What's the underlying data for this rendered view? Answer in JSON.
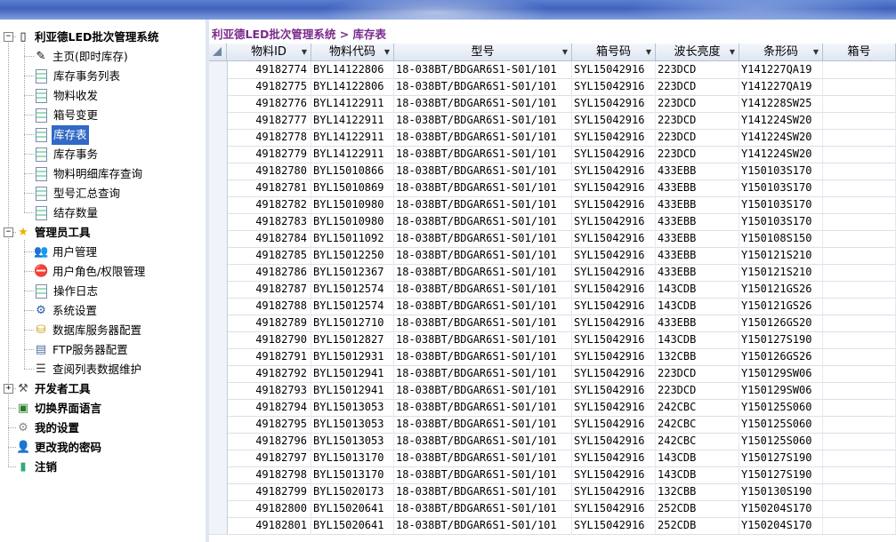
{
  "app": {
    "title": "利亚德LED批次管理系统"
  },
  "breadcrumb": "利亚德LED批次管理系统 > 库存表",
  "tree": [
    {
      "label": "利亚德LED批次管理系统",
      "level": 0,
      "toggle": "−",
      "icon": "book-icon",
      "glyph": "▯"
    },
    {
      "label": "主页(即时库存)",
      "level": 1,
      "icon": "edit-page-icon",
      "glyph": "✎"
    },
    {
      "label": "库存事务列表",
      "level": 1,
      "icon": "page-icon"
    },
    {
      "label": "物料收发",
      "level": 1,
      "icon": "page-icon"
    },
    {
      "label": "箱号变更",
      "level": 1,
      "icon": "page-icon"
    },
    {
      "label": "库存表",
      "level": 1,
      "icon": "page-icon",
      "selected": true
    },
    {
      "label": "库存事务",
      "level": 1,
      "icon": "page-icon"
    },
    {
      "label": "物料明细库存查询",
      "level": 1,
      "icon": "page-icon"
    },
    {
      "label": "型号汇总查询",
      "level": 1,
      "icon": "page-icon"
    },
    {
      "label": "结存数量",
      "level": 1,
      "icon": "page-icon"
    },
    {
      "label": "管理员工具",
      "level": 0,
      "toggle": "−",
      "icon": "star-icon",
      "glyph": "★",
      "color": "#e8b300"
    },
    {
      "label": "用户管理",
      "level": 1,
      "icon": "users-icon",
      "glyph": "👥",
      "color": "#2b6cb0"
    },
    {
      "label": "用户角色/权限管理",
      "level": 1,
      "icon": "no-entry-icon",
      "glyph": "⛔",
      "color": "#d22"
    },
    {
      "label": "操作日志",
      "level": 1,
      "icon": "page-icon"
    },
    {
      "label": "系统设置",
      "level": 1,
      "icon": "settings-page-icon",
      "glyph": "⚙",
      "color": "#2b5aa8"
    },
    {
      "label": "数据库服务器配置",
      "level": 1,
      "icon": "database-icon",
      "glyph": "⛁",
      "color": "#c8a000"
    },
    {
      "label": "FTP服务器配置",
      "level": 1,
      "icon": "server-page-icon",
      "glyph": "▤",
      "color": "#4a6fa5"
    },
    {
      "label": "查阅列表数据维护",
      "level": 1,
      "icon": "list-icon",
      "glyph": "☰",
      "color": "#333"
    },
    {
      "label": "开发者工具",
      "level": 0,
      "toggle": "+",
      "icon": "tools-icon",
      "glyph": "⚒",
      "color": "#555"
    },
    {
      "label": "切换界面语言",
      "level": 0,
      "icon": "chart-icon",
      "glyph": "▣",
      "color": "#2a7a2a"
    },
    {
      "label": "我的设置",
      "level": 0,
      "icon": "user-settings-icon",
      "glyph": "⚙",
      "color": "#888"
    },
    {
      "label": "更改我的密码",
      "level": 0,
      "icon": "user-key-icon",
      "glyph": "👤",
      "color": "#c77"
    },
    {
      "label": "注销",
      "level": 0,
      "icon": "logout-icon",
      "glyph": "▮",
      "color": "#3a7"
    }
  ],
  "grid": {
    "columns": [
      {
        "label": "",
        "width": 20
      },
      {
        "label": "物料ID",
        "width": 95,
        "dropdown": true
      },
      {
        "label": "物料代码",
        "width": 93,
        "dropdown": true
      },
      {
        "label": "型号",
        "width": 200,
        "dropdown": true
      },
      {
        "label": "箱号码",
        "width": 94,
        "dropdown": true
      },
      {
        "label": "波长亮度",
        "width": 94,
        "dropdown": true
      },
      {
        "label": "条形码",
        "width": 94,
        "dropdown": true
      },
      {
        "label": "箱号",
        "width": 82,
        "dropdown": false
      }
    ],
    "rows": [
      [
        "49182774",
        "BYL14122806",
        "18-038BT/BDGAR6S1-S01/101",
        "SYL15042916",
        "223DCD",
        "Y141227QA19",
        ""
      ],
      [
        "49182775",
        "BYL14122806",
        "18-038BT/BDGAR6S1-S01/101",
        "SYL15042916",
        "223DCD",
        "Y141227QA19",
        ""
      ],
      [
        "49182776",
        "BYL14122911",
        "18-038BT/BDGAR6S1-S01/101",
        "SYL15042916",
        "223DCD",
        "Y141228SW25",
        ""
      ],
      [
        "49182777",
        "BYL14122911",
        "18-038BT/BDGAR6S1-S01/101",
        "SYL15042916",
        "223DCD",
        "Y141224SW20",
        ""
      ],
      [
        "49182778",
        "BYL14122911",
        "18-038BT/BDGAR6S1-S01/101",
        "SYL15042916",
        "223DCD",
        "Y141224SW20",
        ""
      ],
      [
        "49182779",
        "BYL14122911",
        "18-038BT/BDGAR6S1-S01/101",
        "SYL15042916",
        "223DCD",
        "Y141224SW20",
        ""
      ],
      [
        "49182780",
        "BYL15010866",
        "18-038BT/BDGAR6S1-S01/101",
        "SYL15042916",
        "433EBB",
        "Y150103S170",
        ""
      ],
      [
        "49182781",
        "BYL15010869",
        "18-038BT/BDGAR6S1-S01/101",
        "SYL15042916",
        "433EBB",
        "Y150103S170",
        ""
      ],
      [
        "49182782",
        "BYL15010980",
        "18-038BT/BDGAR6S1-S01/101",
        "SYL15042916",
        "433EBB",
        "Y150103S170",
        ""
      ],
      [
        "49182783",
        "BYL15010980",
        "18-038BT/BDGAR6S1-S01/101",
        "SYL15042916",
        "433EBB",
        "Y150103S170",
        ""
      ],
      [
        "49182784",
        "BYL15011092",
        "18-038BT/BDGAR6S1-S01/101",
        "SYL15042916",
        "433EBB",
        "Y150108S150",
        ""
      ],
      [
        "49182785",
        "BYL15012250",
        "18-038BT/BDGAR6S1-S01/101",
        "SYL15042916",
        "433EBB",
        "Y150121S210",
        ""
      ],
      [
        "49182786",
        "BYL15012367",
        "18-038BT/BDGAR6S1-S01/101",
        "SYL15042916",
        "433EBB",
        "Y150121S210",
        ""
      ],
      [
        "49182787",
        "BYL15012574",
        "18-038BT/BDGAR6S1-S01/101",
        "SYL15042916",
        "143CDB",
        "Y150121GS26",
        ""
      ],
      [
        "49182788",
        "BYL15012574",
        "18-038BT/BDGAR6S1-S01/101",
        "SYL15042916",
        "143CDB",
        "Y150121GS26",
        ""
      ],
      [
        "49182789",
        "BYL15012710",
        "18-038BT/BDGAR6S1-S01/101",
        "SYL15042916",
        "433EBB",
        "Y150126GS20",
        ""
      ],
      [
        "49182790",
        "BYL15012827",
        "18-038BT/BDGAR6S1-S01/101",
        "SYL15042916",
        "143CDB",
        "Y150127S190",
        ""
      ],
      [
        "49182791",
        "BYL15012931",
        "18-038BT/BDGAR6S1-S01/101",
        "SYL15042916",
        "132CBB",
        "Y150126GS26",
        ""
      ],
      [
        "49182792",
        "BYL15012941",
        "18-038BT/BDGAR6S1-S01/101",
        "SYL15042916",
        "223DCD",
        "Y150129SW06",
        ""
      ],
      [
        "49182793",
        "BYL15012941",
        "18-038BT/BDGAR6S1-S01/101",
        "SYL15042916",
        "223DCD",
        "Y150129SW06",
        ""
      ],
      [
        "49182794",
        "BYL15013053",
        "18-038BT/BDGAR6S1-S01/101",
        "SYL15042916",
        "242CBC",
        "Y150125S060",
        ""
      ],
      [
        "49182795",
        "BYL15013053",
        "18-038BT/BDGAR6S1-S01/101",
        "SYL15042916",
        "242CBC",
        "Y150125S060",
        ""
      ],
      [
        "49182796",
        "BYL15013053",
        "18-038BT/BDGAR6S1-S01/101",
        "SYL15042916",
        "242CBC",
        "Y150125S060",
        ""
      ],
      [
        "49182797",
        "BYL15013170",
        "18-038BT/BDGAR6S1-S01/101",
        "SYL15042916",
        "143CDB",
        "Y150127S190",
        ""
      ],
      [
        "49182798",
        "BYL15013170",
        "18-038BT/BDGAR6S1-S01/101",
        "SYL15042916",
        "143CDB",
        "Y150127S190",
        ""
      ],
      [
        "49182799",
        "BYL15020173",
        "18-038BT/BDGAR6S1-S01/101",
        "SYL15042916",
        "132CBB",
        "Y150130S190",
        ""
      ],
      [
        "49182800",
        "BYL15020641",
        "18-038BT/BDGAR6S1-S01/101",
        "SYL15042916",
        "252CDB",
        "Y150204S170",
        ""
      ],
      [
        "49182801",
        "BYL15020641",
        "18-038BT/BDGAR6S1-S01/101",
        "SYL15042916",
        "252CDB",
        "Y150204S170",
        ""
      ]
    ]
  }
}
